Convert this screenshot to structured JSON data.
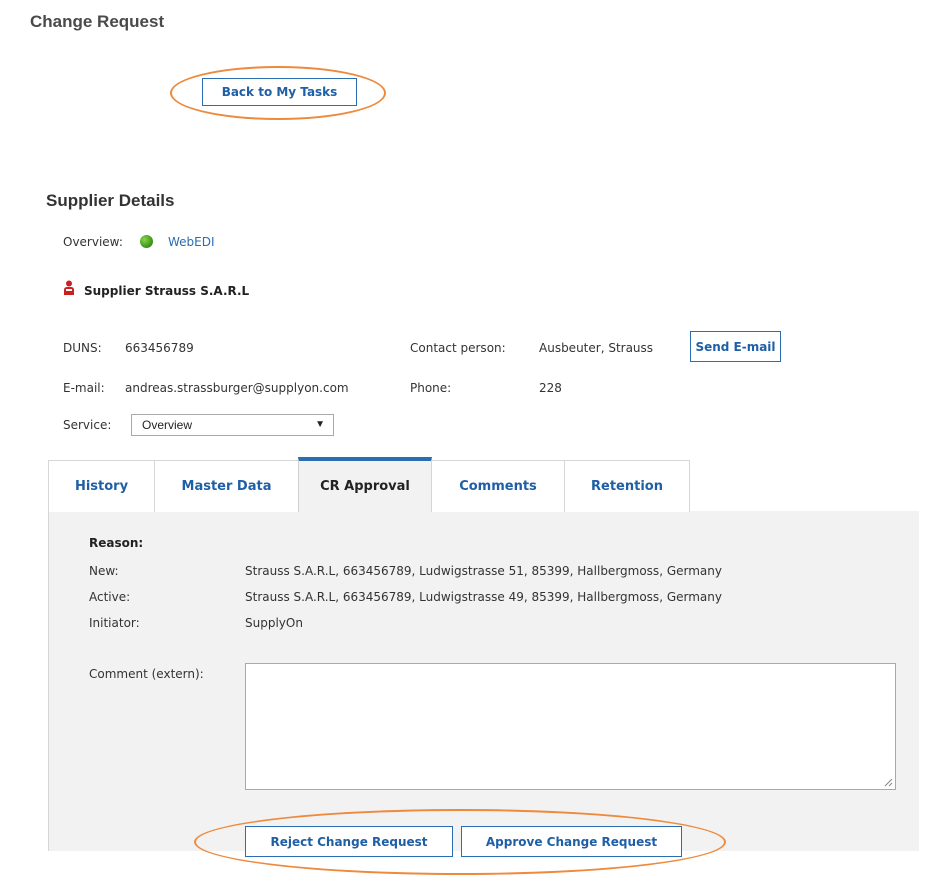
{
  "page": {
    "title": "Change Request"
  },
  "back_button": {
    "label": "Back to My Tasks"
  },
  "supplier": {
    "section_title": "Supplier Details",
    "overview_label": "Overview:",
    "overview_status_color": "#3f9a1a",
    "overview_link": "WebEDI",
    "name": "Supplier Strauss S.A.R.L",
    "icon": "supplier-person-icon",
    "duns_label": "DUNS:",
    "duns_value": "663456789",
    "contact_label": "Contact person:",
    "contact_value": "Ausbeuter, Strauss",
    "send_email_label": "Send E-mail",
    "email_label": "E-mail:",
    "email_value": "andreas.strassburger@supplyon.com",
    "phone_label": "Phone:",
    "phone_value": "228",
    "service_label": "Service:",
    "service_selected": "Overview"
  },
  "tabs": [
    {
      "label": "History",
      "active": false
    },
    {
      "label": "Master Data",
      "active": false
    },
    {
      "label": "CR Approval",
      "active": true
    },
    {
      "label": "Comments",
      "active": false
    },
    {
      "label": "Retention",
      "active": false
    }
  ],
  "cr_approval": {
    "reason_title": "Reason:",
    "rows": [
      {
        "label": "New:",
        "value": "Strauss S.A.R.L, 663456789, Ludwigstrasse 51, 85399, Hallbergmoss, Germany"
      },
      {
        "label": "Active:",
        "value": "Strauss S.A.R.L, 663456789, Ludwigstrasse 49, 85399, Hallbergmoss, Germany"
      },
      {
        "label": "Initiator:",
        "value": "SupplyOn"
      }
    ],
    "comment_label": "Comment (extern):",
    "comment_value": "",
    "reject_label": "Reject Change Request",
    "approve_label": "Approve Change Request"
  },
  "colors": {
    "accent": "#2a6db0",
    "highlight": "#ee8a3c",
    "panel_bg": "#f2f2f2"
  }
}
